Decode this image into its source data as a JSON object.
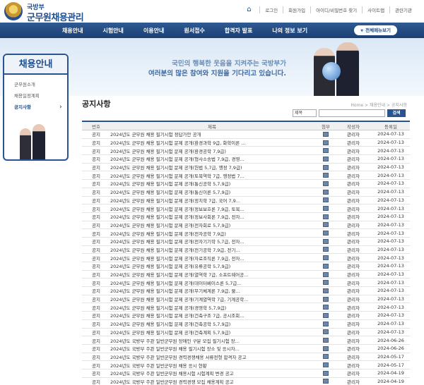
{
  "header": {
    "logo_sub": "국방부",
    "logo_main": "군무원채용관리",
    "util_links": [
      "로그인",
      "회원가입",
      "아이디/비밀번호 찾기",
      "사이트맵",
      "관련기관"
    ]
  },
  "gnb": {
    "menu": [
      "채용안내",
      "시험안내",
      "이용안내",
      "원서접수",
      "합격자 발표",
      "나의 정보 보기"
    ],
    "all_menu": "전체메뉴보기"
  },
  "banner": {
    "line1": "국민의 행복한 웃음을 지켜주는 국방부가",
    "line2": "여러분의 많은 참여와 지원을 기다리고 있습니다."
  },
  "sidebar": {
    "title": "채용안내",
    "items": [
      "군무원소개",
      "채용일정계획",
      "공지사항"
    ],
    "active_index": 2
  },
  "page": {
    "title": "공지사항",
    "breadcrumb": "Home > 채용안내 > 공지사항"
  },
  "search": {
    "select_value": "제목",
    "button": "검색"
  },
  "table": {
    "headers": [
      "번호",
      "제목",
      "첨부",
      "작성자",
      "등록일"
    ],
    "rows": [
      {
        "no": "공지",
        "title": "2024년도 군무원 채용 필기시험 정답가안 공개",
        "writer": "관리자",
        "date": "2024-07-13"
      },
      {
        "no": "공지",
        "title": "2024년도 군무원 채용 필기시험 문제 공개(환경과학 9급, 화학이론 ...",
        "writer": "관리자",
        "date": "2024-07-13"
      },
      {
        "no": "공지",
        "title": "2024년도 군무원 채용 필기시험 문제 공개(환경공학 7,9급)",
        "writer": "관리자",
        "date": "2024-07-13"
      },
      {
        "no": "공지",
        "title": "2024년도 군무원 채용 필기시험 문제 공개(형사소송법 7,9급, 경영...",
        "writer": "관리자",
        "date": "2024-07-13"
      },
      {
        "no": "공지",
        "title": "2024년도 군무원 채용 필기시험 문제 공개(헌법 5,7급, 행정 7,9급)",
        "writer": "관리자",
        "date": "2024-07-13"
      },
      {
        "no": "공지",
        "title": "2024년도 군무원 채용 필기시험 문제 공개(토목역학 7급, 행정법 7...",
        "writer": "관리자",
        "date": "2024-07-13"
      },
      {
        "no": "공지",
        "title": "2024년도 군무원 채용 필기시험 문제 공개(통신공학 5,7,9급)",
        "writer": "관리자",
        "date": "2024-07-13"
      },
      {
        "no": "공지",
        "title": "2024년도 군무원 채용 필기시험 문제 공개(통신이론 5,7,9급)",
        "writer": "관리자",
        "date": "2024-07-13"
      },
      {
        "no": "공지",
        "title": "2024년도 군무원 채용 필기시험 문제 공개(정치학 7급, 국어 7,9...",
        "writer": "관리자",
        "date": "2024-07-13"
      },
      {
        "no": "공지",
        "title": "2024년도 군무원 채용 필기시험 문제 공개(정보보호론 7,9급, 토목...",
        "writer": "관리자",
        "date": "2024-07-13"
      },
      {
        "no": "공지",
        "title": "2024년도 군무원 채용 필기시험 문제 공개(정보사회론 7,9급, 전자...",
        "writer": "관리자",
        "date": "2024-07-13"
      },
      {
        "no": "공지",
        "title": "2024년도 군무원 채용 필기시험 문제 공개(전자회로 5,7,9급)",
        "writer": "관리자",
        "date": "2024-07-13"
      },
      {
        "no": "공지",
        "title": "2024년도 군무원 채용 필기시험 문제 공개(전자공학 7,9급)",
        "writer": "관리자",
        "date": "2024-07-13"
      },
      {
        "no": "공지",
        "title": "2024년도 군무원 채용 필기시험 문제 공개(전자기기학 5,7급, 전자...",
        "writer": "관리자",
        "date": "2024-07-13"
      },
      {
        "no": "공지",
        "title": "2024년도 군무원 채용 필기시험 문제 공개(전기공학 7,9급, 전기...",
        "writer": "관리자",
        "date": "2024-07-13"
      },
      {
        "no": "공지",
        "title": "2024년도 군무원 채용 필기시험 문제 공개(자료조직론 7,9급, 전자...",
        "writer": "관리자",
        "date": "2024-07-13"
      },
      {
        "no": "공지",
        "title": "2024년도 군무원 채용 필기시험 문제 공개(유류공학 5,7,9급)",
        "writer": "관리자",
        "date": "2024-07-13"
      },
      {
        "no": "공지",
        "title": "2024년도 군무원 채용 필기시험 문제 공개(열역학 7급, 소프트웨어공...",
        "writer": "관리자",
        "date": "2024-07-13"
      },
      {
        "no": "공지",
        "title": "2024년도 군무원 채용 필기시험 문제 공개(데이터베이스론 5,7급...",
        "writer": "관리자",
        "date": "2024-07-13"
      },
      {
        "no": "공지",
        "title": "2024년도 군무원 채용 필기시험 문제 공개(무기체계론 7,9급, 물...",
        "writer": "관리자",
        "date": "2024-07-13"
      },
      {
        "no": "공지",
        "title": "2024년도 군무원 채용 필기시험 문제 공개(기계열역학 7급, 기계공학...",
        "writer": "관리자",
        "date": "2024-07-13"
      },
      {
        "no": "공지",
        "title": "2024년도 군무원 채용 필기시험 문제 공개(경영학 5,7,9급)",
        "writer": "관리자",
        "date": "2024-07-13"
      },
      {
        "no": "공지",
        "title": "2024년도 군무원 채용 필기시험 문제 공개(건축구조 7급, 공시조회...",
        "writer": "관리자",
        "date": "2024-07-13"
      },
      {
        "no": "공지",
        "title": "2024년도 군무원 채용 필기시험 문제 공개(건축공학 5,7,9급)",
        "writer": "관리자",
        "date": "2024-07-13"
      },
      {
        "no": "공지",
        "title": "2024년도 군무원 채용 필기시험 문제 공개(건축계획 5,7,9급)",
        "writer": "관리자",
        "date": "2024-07-13"
      },
      {
        "no": "공지",
        "title": "2024년도 국방부 주관 일반군무원 장애인 구분 모집 필기시험 장...",
        "writer": "관리자",
        "date": "2024-06-26"
      },
      {
        "no": "공지",
        "title": "2024년도 국방부 주관 일반군무원 채용 필기시험 장소 및 응시자...",
        "writer": "관리자",
        "date": "2024-06-26"
      },
      {
        "no": "공지",
        "title": "2024년도 국방부 주관 일반군무원 경력경쟁채용 서류전형 합격자 공고",
        "writer": "관리자",
        "date": "2024-05-17"
      },
      {
        "no": "공지",
        "title": "2024년도 국방부 주관 일반군무원 채용 응시 현황",
        "writer": "관리자",
        "date": "2024-05-17"
      },
      {
        "no": "공지",
        "title": "2024년도 국방부 주관 일반군무원 채용시험 시험계획 변경 공고",
        "writer": "관리자",
        "date": "2024-04-19"
      },
      {
        "no": "공지",
        "title": "2024년도 국방부 주관 일반군무원 경력경쟁 모집 채용계획 공고",
        "writer": "관리자",
        "date": "2024-04-19"
      },
      {
        "no": "공지",
        "title": "2024년도 국방부 주관 일반군무원 채용시험 시행계획 공고",
        "writer": "관리자",
        "date": "2024-04-19"
      }
    ]
  }
}
